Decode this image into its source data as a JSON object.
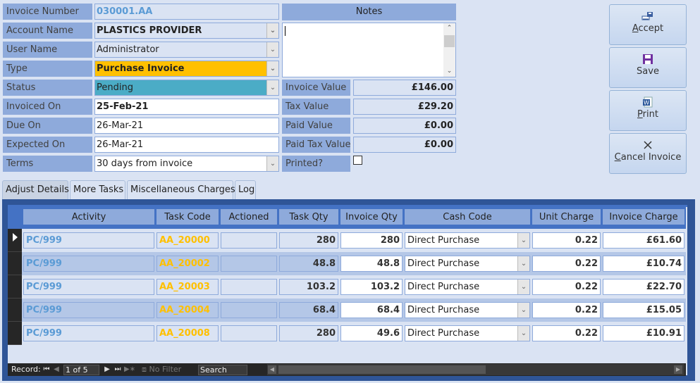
{
  "form": {
    "fields": [
      {
        "label": "Invoice Number",
        "value": "030001.AA"
      },
      {
        "label": "Account Name",
        "value": "PLASTICS PROVIDER"
      },
      {
        "label": "User Name",
        "value": "Administrator"
      },
      {
        "label": "Type",
        "value": "Purchase Invoice"
      },
      {
        "label": "Status",
        "value": "Pending"
      },
      {
        "label": "Invoiced On",
        "value": "25-Feb-21"
      },
      {
        "label": "Due On",
        "value": "26-Mar-21"
      },
      {
        "label": "Expected On",
        "value": "26-Mar-21"
      },
      {
        "label": "Terms",
        "value": "30 days from invoice"
      }
    ],
    "notes_label": "Notes",
    "notes_value": "",
    "totals": [
      {
        "label": "Invoice Value",
        "value": "£146.00"
      },
      {
        "label": "Tax Value",
        "value": "£29.20"
      },
      {
        "label": "Paid Value",
        "value": "£0.00"
      },
      {
        "label": "Paid Tax Value:",
        "value": "£0.00"
      }
    ],
    "printed_label": "Printed?",
    "printed_checked": false,
    "colors": {
      "type_bg": "#ffc000",
      "status_bg": "#4bacc6",
      "label_bg": "#8eaadb",
      "accent": "#2f5597"
    }
  },
  "buttons": {
    "accept": {
      "pre": "",
      "key": "A",
      "post": "ccept",
      "icon": "accept-icon"
    },
    "save": {
      "pre": "Save",
      "key": "",
      "post": "",
      "icon": "save-icon"
    },
    "print": {
      "pre": "",
      "key": "P",
      "post": "rint",
      "icon": "word-print-icon"
    },
    "cancel": {
      "pre": "",
      "key": "C",
      "post": "ancel Invoice",
      "icon": "close-icon"
    }
  },
  "tabs": [
    {
      "label": "Adjust Details",
      "active": true
    },
    {
      "label": "More Tasks",
      "active": false
    },
    {
      "label": "Miscellaneous Charges",
      "active": false
    },
    {
      "label": "Log",
      "active": false
    }
  ],
  "grid": {
    "columns": [
      "Activity",
      "Task Code",
      "Actioned",
      "Task Qty",
      "Invoice Qty",
      "Cash Code",
      "Unit Charge",
      "Invoice Charge"
    ],
    "rows": [
      {
        "activity": "PC/999",
        "task_code": "AA_20000",
        "actioned": "",
        "task_qty": "280",
        "invoice_qty": "280",
        "cash_code": "Direct Purchase",
        "unit_charge": "0.22",
        "invoice_charge": "£61.60"
      },
      {
        "activity": "PC/999",
        "task_code": "AA_20002",
        "actioned": "",
        "task_qty": "48.8",
        "invoice_qty": "48.8",
        "cash_code": "Direct Purchase",
        "unit_charge": "0.22",
        "invoice_charge": "£10.74"
      },
      {
        "activity": "PC/999",
        "task_code": "AA_20003",
        "actioned": "",
        "task_qty": "103.2",
        "invoice_qty": "103.2",
        "cash_code": "Direct Purchase",
        "unit_charge": "0.22",
        "invoice_charge": "£22.70"
      },
      {
        "activity": "PC/999",
        "task_code": "AA_20004",
        "actioned": "",
        "task_qty": "68.4",
        "invoice_qty": "68.4",
        "cash_code": "Direct Purchase",
        "unit_charge": "0.22",
        "invoice_charge": "£15.05"
      },
      {
        "activity": "PC/999",
        "task_code": "AA_20008",
        "actioned": "",
        "task_qty": "280",
        "invoice_qty": "49.6",
        "cash_code": "Direct Purchase",
        "unit_charge": "0.22",
        "invoice_charge": "£10.91"
      }
    ]
  },
  "navigation": {
    "record_label": "Record:",
    "position": "1 of 5",
    "filter_label": "No Filter",
    "search_label": "Search"
  }
}
